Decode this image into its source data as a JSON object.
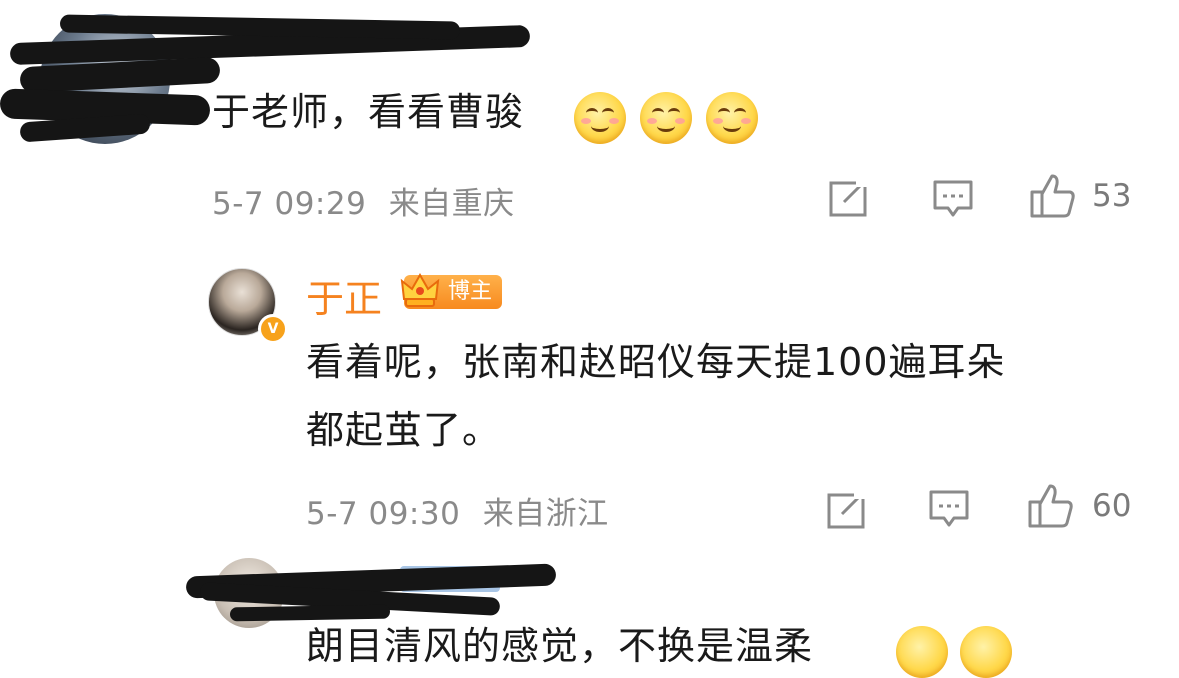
{
  "comment1": {
    "text": "于老师，看看曹骏",
    "time": "5-7 09:29",
    "location": "来自重庆",
    "likes": "53",
    "emoji_count": 3
  },
  "reply": {
    "author": "于正",
    "badge": "博主",
    "text_line1": "看着呢，张南和赵昭仪每天提100遍耳朵",
    "text_line2": "都起茧了。",
    "time": "5-7 09:30",
    "location": "来自浙江",
    "likes": "60"
  },
  "comment3": {
    "text_partial": "朗目清风的感觉，不换是温柔"
  },
  "icons": {
    "share": "share-icon",
    "comment": "comment-icon",
    "like": "like-icon"
  },
  "colors": {
    "author": "#f5821f",
    "meta": "#8a8a8a"
  }
}
